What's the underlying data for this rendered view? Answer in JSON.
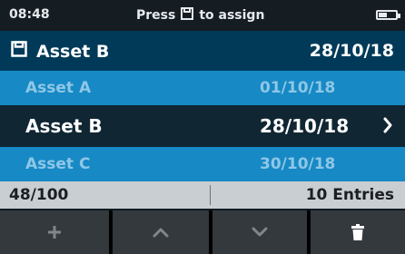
{
  "status": {
    "time": "08:48",
    "hint_before": "Press",
    "hint_after": "to assign",
    "hint_icon": "save-icon",
    "battery_icon": "battery-icon"
  },
  "header": {
    "icon": "save-icon",
    "title": "Asset B",
    "date": "28/10/18"
  },
  "list": {
    "items": [
      {
        "name": "Asset A",
        "date": "01/10/18",
        "selected": false
      },
      {
        "name": "Asset B",
        "date": "28/10/18",
        "selected": true
      },
      {
        "name": "Asset C",
        "date": "30/10/18",
        "selected": false
      }
    ]
  },
  "info": {
    "count": "48/100",
    "entries": "10 Entries"
  },
  "softkeys": [
    {
      "icon": "plus-icon"
    },
    {
      "icon": "chevron-up-icon"
    },
    {
      "icon": "chevron-down-icon"
    },
    {
      "icon": "trash-icon"
    }
  ],
  "colors": {
    "header_bg": "#003a58",
    "row_bg": "#1789c5",
    "selected_row_bg": "#102633",
    "info_bg": "#c9ced3",
    "softkey_bg": "#34393e"
  }
}
